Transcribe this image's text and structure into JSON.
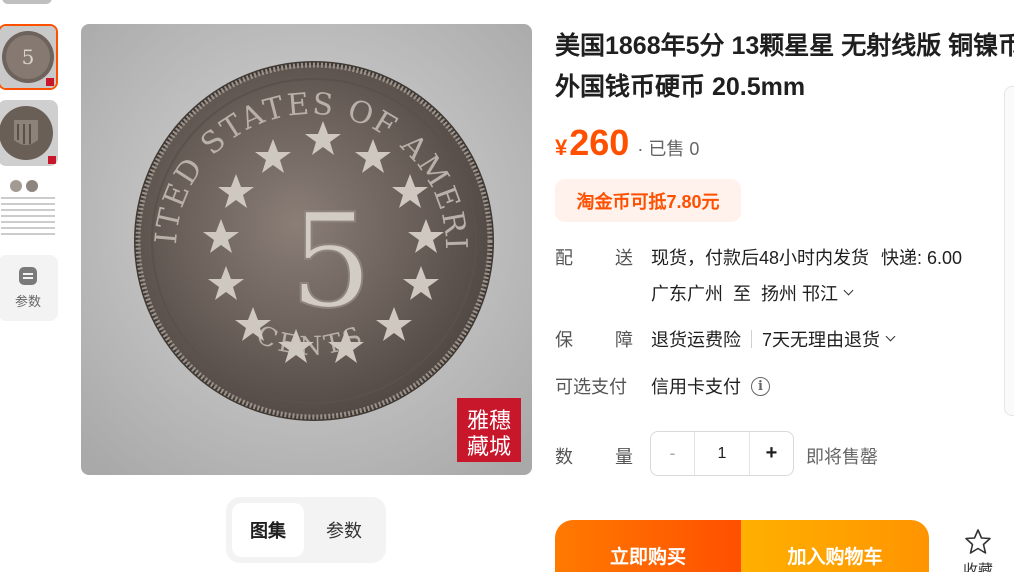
{
  "product": {
    "title": "美国1868年5分 13颗星星 无射线版 铜镍币 外国钱币硬币 20.5mm",
    "currency_symbol": "¥",
    "price": "260",
    "sold": "· 已售 0",
    "coupon": "淘金币可抵7.80元"
  },
  "gallery": {
    "param_thumb_label": "参数",
    "tabs": [
      "图集",
      "参数"
    ],
    "coin_text_top": "UNITED STATES OF AMERICA",
    "coin_text_bottom": "CENTS",
    "coin_denomination": "5",
    "seal_text": "雅穗藏城"
  },
  "delivery": {
    "label": [
      "配",
      "送"
    ],
    "value": "现货，付款后48小时内发货",
    "shipping": "快递: 6.00",
    "from": "广东广州",
    "to_word": "至",
    "destination": "扬州 邗江"
  },
  "guarantee": {
    "label": [
      "保",
      "障"
    ],
    "item1": "退货运费险",
    "item2": "7天无理由退货"
  },
  "payment": {
    "label": "可选支付",
    "value": "信用卡支付",
    "info_icon": "i"
  },
  "quantity": {
    "label": [
      "数",
      "量"
    ],
    "minus": "-",
    "value": "1",
    "plus": "+",
    "note": "即将售罄"
  },
  "actions": {
    "buy_now": "立即购买",
    "add_cart": "加入购物车",
    "favorite": "收藏"
  },
  "colors": {
    "accent": "#ff5000",
    "coupon_bg": "#fff1eb",
    "cart": "#ffa200"
  }
}
